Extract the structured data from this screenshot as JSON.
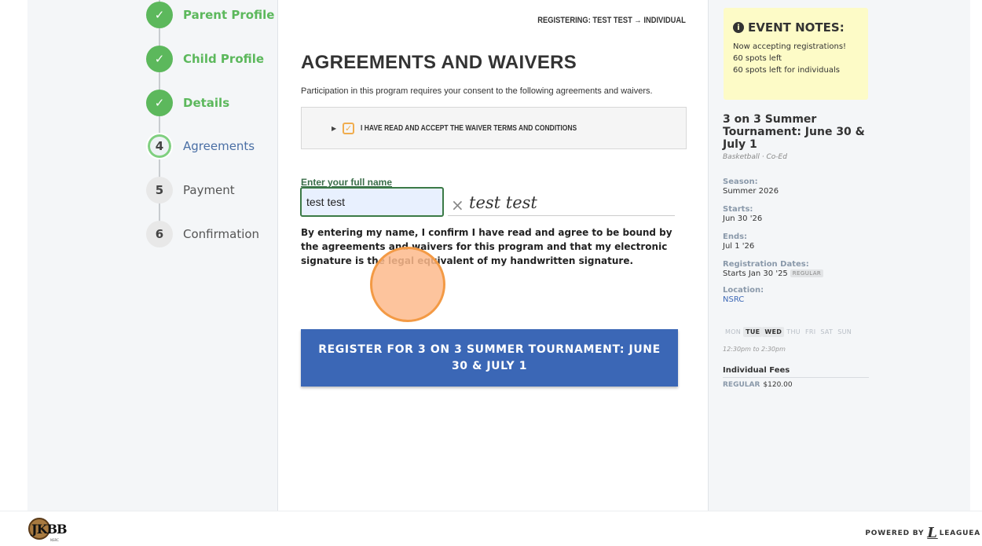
{
  "steps": [
    {
      "num": "1",
      "label": "Parent Profile",
      "state": "done"
    },
    {
      "num": "2",
      "label": "Child Profile",
      "state": "done"
    },
    {
      "num": "3",
      "label": "Details",
      "state": "done"
    },
    {
      "num": "4",
      "label": "Agreements",
      "state": "current"
    },
    {
      "num": "5",
      "label": "Payment",
      "state": "todo"
    },
    {
      "num": "6",
      "label": "Confirmation",
      "state": "todo"
    }
  ],
  "main": {
    "registering": "REGISTERING: TEST TEST → INDIVIDUAL",
    "title": "AGREEMENTS AND WAIVERS",
    "intro": "Participation in this program requires your consent to the following agreements and waivers.",
    "waiver_label": "I HAVE READ AND ACCEPT THE WAIVER TERMS AND CONDITIONS",
    "name_label": "Enter your full name",
    "name_value": "test test",
    "signature": "test test",
    "consent": "By entering my name, I confirm I have read and agree to be bound by the agreements and waivers for this program and that my electronic signature is the legal equivalent of my handwritten signature.",
    "register_button": "REGISTER FOR 3 ON 3 SUMMER TOURNAMENT: JUNE 30 & JULY 1"
  },
  "notes": {
    "title": "EVENT NOTES:",
    "lines": [
      "Now accepting registrations!",
      "60 spots left",
      "60 spots left for individuals"
    ]
  },
  "event": {
    "title": "3 on 3 Summer Tournament: June 30 & July 1",
    "subtitle": "Basketball · Co-Ed",
    "season_label": "Season:",
    "season": "Summer 2026",
    "starts_label": "Starts:",
    "starts": "Jun 30 '26",
    "ends_label": "Ends:",
    "ends": "Jul 1 '26",
    "reg_label": "Registration Dates:",
    "reg_dates": "Starts Jan 30 '25",
    "reg_badge": "REGULAR",
    "location_label": "Location:",
    "location": "NSRC",
    "days": [
      {
        "d": "MON",
        "on": false
      },
      {
        "d": "TUE",
        "on": true
      },
      {
        "d": "WED",
        "on": true
      },
      {
        "d": "THU",
        "on": false
      },
      {
        "d": "FRI",
        "on": false
      },
      {
        "d": "SAT",
        "on": false
      },
      {
        "d": "SUN",
        "on": false
      }
    ],
    "time": "12:30pm to 2:30pm",
    "fees_header": "Individual Fees",
    "fee_type": "REGULAR",
    "fee_amount": "$120.00"
  },
  "footer": {
    "logo_text": "JKBB",
    "logo_sub": "NSRC",
    "powered": "POWERED BY",
    "powered_brand": "LEAGUEA"
  },
  "colors": {
    "done": "#5cb85c",
    "primary": "#3b67b6",
    "checkbox": "#f0ad4e",
    "notes_bg": "#fdfbc7"
  }
}
